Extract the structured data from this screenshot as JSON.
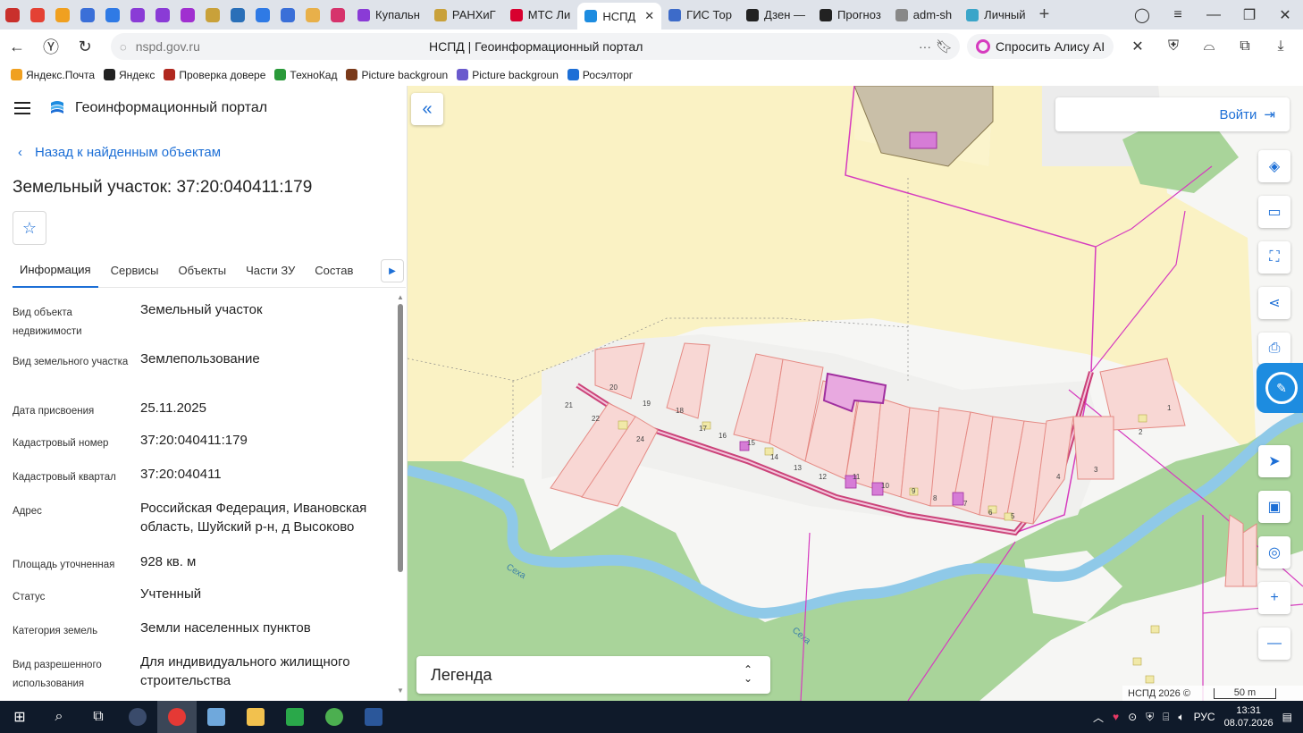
{
  "browser": {
    "tabs": [
      {
        "label": "Купальн",
        "color": "#8a3bd6"
      },
      {
        "label": "РАНХиГ",
        "color": "#c9a13a"
      },
      {
        "label": "МТС Ли",
        "color": "#d8002f"
      },
      {
        "label": "НСПД",
        "color": "#1d8ce0",
        "active": true
      },
      {
        "label": "ГИС Тор",
        "color": "#3d6bc9"
      },
      {
        "label": "Дзен —",
        "color": "#222222"
      },
      {
        "label": "Прогноз",
        "color": "#222222"
      },
      {
        "label": "adm-sh",
        "color": "#666666"
      },
      {
        "label": "Личный",
        "color": "#3aa5c9"
      }
    ],
    "address": {
      "url": "nspd.gov.ru",
      "page_title": "НСПД | Геоинформационный портал",
      "alice_label": "Спросить Алису AI"
    },
    "bookmarks": [
      {
        "label": "Яндекс.Почта",
        "color": "#f0a020"
      },
      {
        "label": "Яндекс",
        "color": "#222222"
      },
      {
        "label": "Проверка довере",
        "color": "#b0281f"
      },
      {
        "label": "ТехноКад",
        "color": "#2a9a3a"
      },
      {
        "label": "Picture backgroun",
        "color": "#7a3a1a"
      },
      {
        "label": "Picture backgroun",
        "color": "#6a5acd"
      },
      {
        "label": "Росэлторг",
        "color": "#1d6fd6"
      }
    ]
  },
  "panel": {
    "portal_name": "Геоинформационный портал",
    "back_label": "Назад к найденным объектам",
    "title": "Земельный участок: 37:20:040411:179",
    "tabs": [
      "Информация",
      "Сервисы",
      "Объекты",
      "Части ЗУ",
      "Состав"
    ],
    "fields": [
      {
        "label": "Вид объекта недвижимости",
        "value": "Земельный участок"
      },
      {
        "label": "Вид земельного участка",
        "value": "Землепользование"
      },
      {
        "label": "Дата присвоения",
        "value": "25.11.2025"
      },
      {
        "label": "Кадастровый номер",
        "value": "37:20:040411:179"
      },
      {
        "label": "Кадастровый квартал",
        "value": "37:20:040411"
      },
      {
        "label": "Адрес",
        "value": "Российская Федерация, Ивановская область, Шуйский р-н, д Высоково"
      },
      {
        "label": "Площадь уточненная",
        "value": "928 кв. м"
      },
      {
        "label": "Статус",
        "value": "Учтенный"
      },
      {
        "label": "Категория земель",
        "value": "Земли населенных пунктов"
      },
      {
        "label": "Вид разрешенного использования",
        "value": "Для индивидуального жилищного строительства"
      }
    ]
  },
  "map": {
    "login_label": "Войти",
    "legend_label": "Легенда",
    "attribution": "НСПД 2026 ©",
    "scale_label": "50 m",
    "river_label": "Сеха",
    "parcel_numbers": [
      "20",
      "21",
      "22",
      "19",
      "18",
      "17",
      "16",
      "24",
      "15",
      "14",
      "13",
      "12",
      "11",
      "10",
      "9",
      "8",
      "7",
      "6",
      "5",
      "4",
      "3",
      "2",
      "1"
    ]
  },
  "taskbar": {
    "lang": "РУС",
    "time": "13:31",
    "date": "08.07.2026"
  }
}
